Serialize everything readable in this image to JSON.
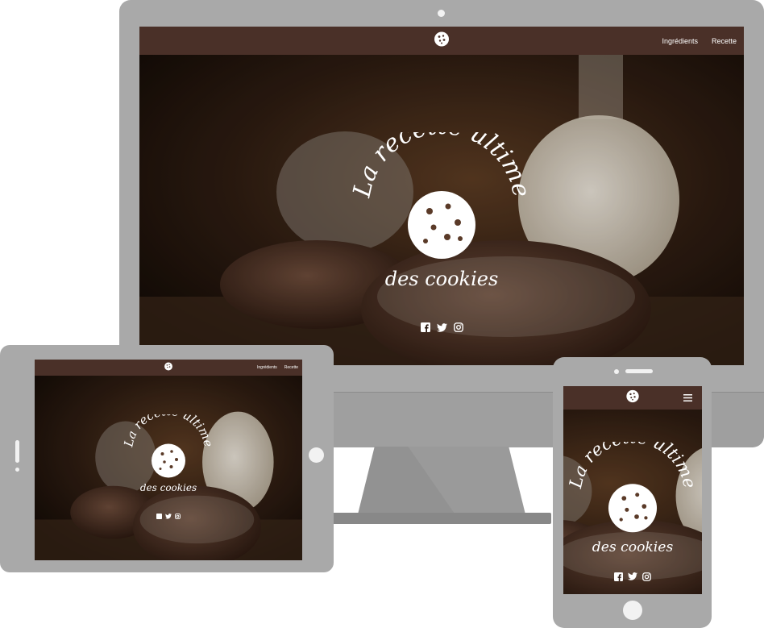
{
  "site": {
    "title_line1": "La recette ultime",
    "title_line2": "des cookies"
  },
  "nav": {
    "logo_icon": "cookie-icon",
    "links": [
      {
        "label": "Ingrédients"
      },
      {
        "label": "Recette"
      }
    ],
    "menu_icon": "hamburger-menu-icon"
  },
  "social_icons": [
    "facebook-icon",
    "twitter-icon",
    "instagram-icon"
  ],
  "colors": {
    "navbar": "#4a3028",
    "device_frame": "#a9a9a9",
    "title": "#ffffff"
  }
}
